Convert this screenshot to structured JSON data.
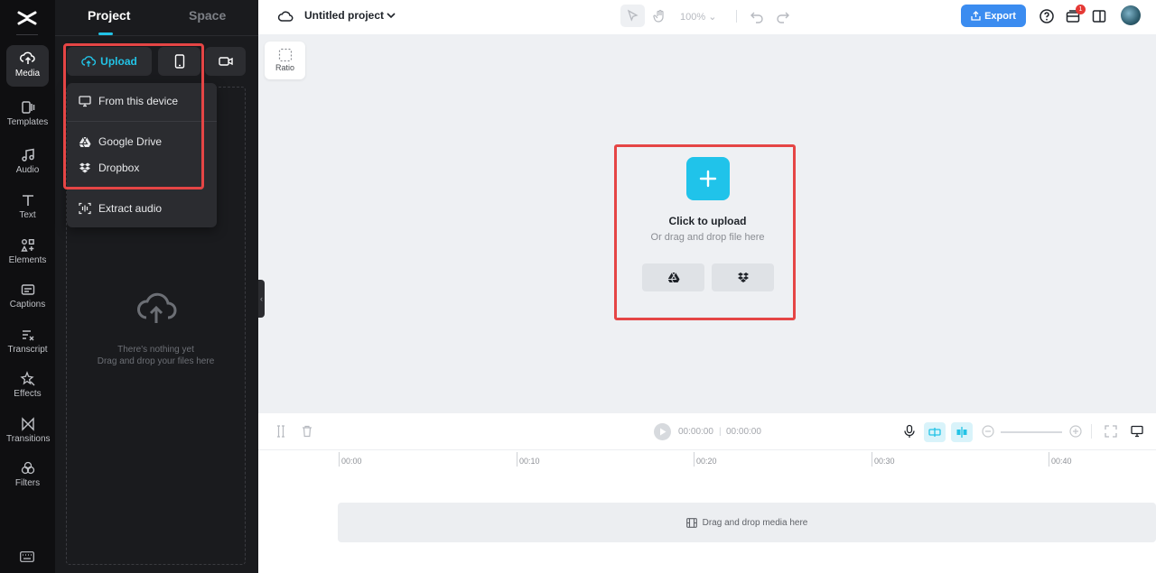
{
  "rail": {
    "items": [
      {
        "label": "Media",
        "icon": "media-icon"
      },
      {
        "label": "Templates",
        "icon": "templates-icon"
      },
      {
        "label": "Audio",
        "icon": "audio-icon"
      },
      {
        "label": "Text",
        "icon": "text-icon"
      },
      {
        "label": "Elements",
        "icon": "elements-icon"
      },
      {
        "label": "Captions",
        "icon": "captions-icon"
      },
      {
        "label": "Transcript",
        "icon": "transcript-icon"
      },
      {
        "label": "Effects",
        "icon": "effects-icon"
      },
      {
        "label": "Transitions",
        "icon": "transitions-icon"
      },
      {
        "label": "Filters",
        "icon": "filters-icon"
      }
    ],
    "active": "Media"
  },
  "panel": {
    "tabs": [
      {
        "label": "Project"
      },
      {
        "label": "Space"
      }
    ],
    "upload_label": "Upload",
    "empty_line1": "There's nothing yet",
    "empty_line2": "Drag and drop your files here"
  },
  "menu": {
    "items": [
      {
        "label": "From this device",
        "icon": "monitor-icon"
      },
      {
        "label": "Google Drive",
        "icon": "google-drive-icon"
      },
      {
        "label": "Dropbox",
        "icon": "dropbox-icon"
      },
      {
        "label": "Extract audio",
        "icon": "extract-audio-icon"
      }
    ]
  },
  "topbar": {
    "project_title": "Untitled project",
    "zoom": "100%",
    "export_label": "Export",
    "notification_count": "1"
  },
  "canvas": {
    "ratio_label": "Ratio",
    "upload_title": "Click to upload",
    "upload_subtitle": "Or drag and drop file here"
  },
  "timeline": {
    "current_time": "00:00:00",
    "total_time": "00:00:00",
    "ruler": [
      "00:00",
      "00:10",
      "00:20",
      "00:30",
      "00:40"
    ],
    "track_hint": "Drag and drop media here"
  },
  "colors": {
    "accent": "#22c3e6",
    "export": "#3b8cf0",
    "highlight_box": "#e54545"
  }
}
